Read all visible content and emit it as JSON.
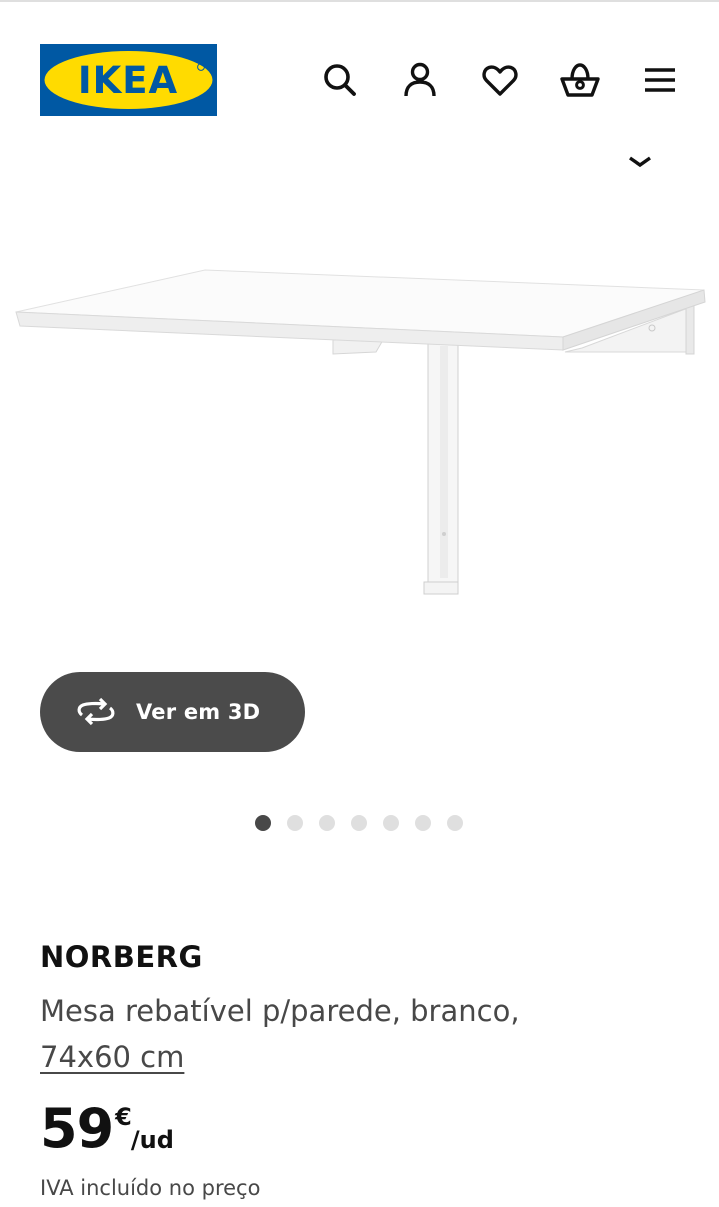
{
  "header": {
    "logo_text": "IKEA",
    "icons": [
      "search-icon",
      "user-icon",
      "heart-icon",
      "basket-icon",
      "menu-icon"
    ]
  },
  "colors": {
    "ikea_blue": "#0058a3",
    "ikea_yellow": "#ffdb00",
    "button_bg": "#4b4b4b",
    "dot_active": "#484848",
    "dot_inactive": "#dfdfdf"
  },
  "gallery": {
    "view_3d_label": "Ver em 3D",
    "dots_total": 7,
    "active_dot": 1
  },
  "product": {
    "name": "NORBERG",
    "description": "Mesa rebatível p/parede, branco,",
    "size": "74x60 cm",
    "price_integer": "59",
    "currency": "€",
    "unit": "/ud",
    "vat_note": "IVA incluído no preço"
  }
}
